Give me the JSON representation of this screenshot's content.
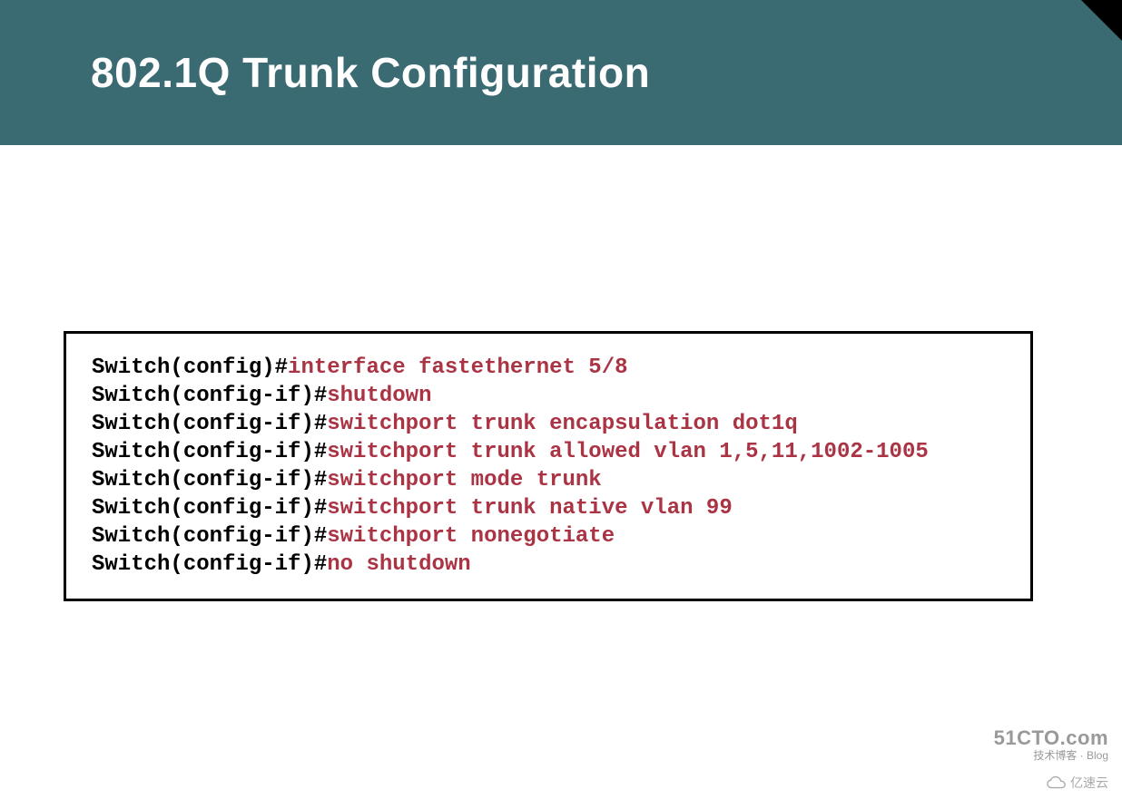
{
  "slide": {
    "title": "802.1Q Trunk Configuration"
  },
  "config": {
    "lines": [
      {
        "prompt": "Switch(config)#",
        "command": "interface fastethernet 5/8"
      },
      {
        "prompt": "Switch(config-if)#",
        "command": "shutdown"
      },
      {
        "prompt": "Switch(config-if)#",
        "command": "switchport trunk encapsulation dot1q"
      },
      {
        "prompt": "Switch(config-if)#",
        "command": "switchport trunk allowed vlan 1,5,11,1002-1005"
      },
      {
        "prompt": "Switch(config-if)#",
        "command": "switchport mode trunk"
      },
      {
        "prompt": "Switch(config-if)#",
        "command": "switchport trunk native vlan 99"
      },
      {
        "prompt": "Switch(config-if)#",
        "command": "switchport nonegotiate"
      },
      {
        "prompt": "Switch(config-if)#",
        "command": "no shutdown"
      }
    ]
  },
  "watermarks": {
    "site1_top": "51CTO.com",
    "site1_bottom": "技术博客 · Blog",
    "site2": "亿速云"
  }
}
